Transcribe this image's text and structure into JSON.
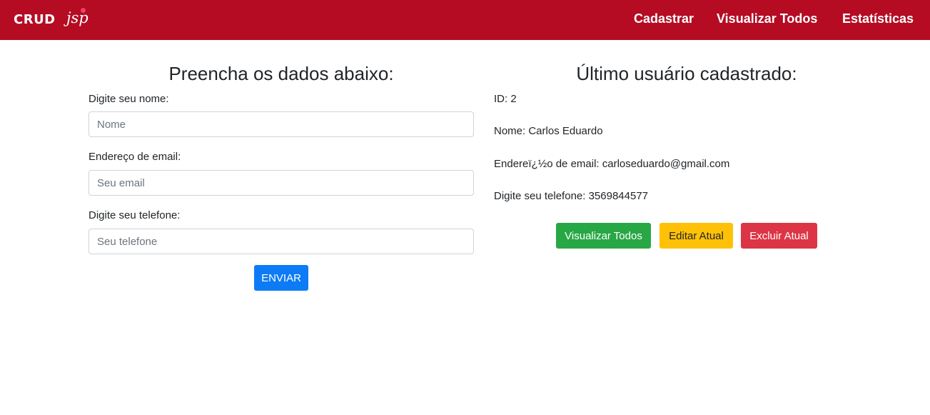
{
  "navbar": {
    "brand_main": "CRUD",
    "brand_sub": "jsp",
    "links": [
      {
        "label": "Cadastrar"
      },
      {
        "label": "Visualizar Todos"
      },
      {
        "label": "Estatísticas"
      }
    ],
    "bg_color": "#b50c24"
  },
  "form": {
    "title": "Preencha os dados abaixo:",
    "name_label": "Digite seu nome:",
    "name_placeholder": "Nome",
    "email_label": "Endereço de email:",
    "email_placeholder": "Seu email",
    "phone_label": "Digite seu telefone:",
    "phone_placeholder": "Seu telefone",
    "submit_label": "ENVIAR"
  },
  "last_user": {
    "title": "Último usuário cadastrado:",
    "id_line": "ID: 2",
    "name_line": "Nome: Carlos Eduardo",
    "email_line": "Endereï¿½o de email: carloseduardo@gmail.com",
    "phone_line": "Digite seu telefone: 3569844577",
    "view_all_label": "Visualizar Todos",
    "edit_label": "Editar Atual",
    "delete_label": "Excluir Atual"
  },
  "colors": {
    "primary": "#0d7bf5",
    "success": "#28a745",
    "warning": "#ffc107",
    "danger": "#dc3545"
  }
}
